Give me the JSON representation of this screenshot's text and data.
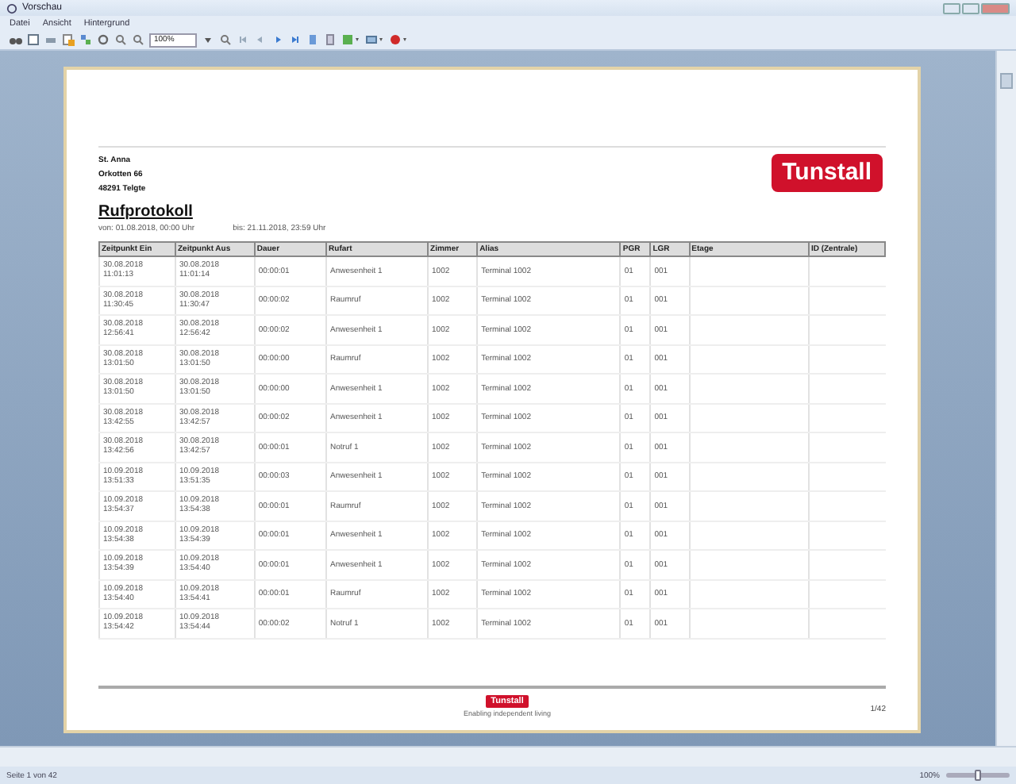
{
  "window": {
    "title": "Vorschau"
  },
  "menu": [
    "Datei",
    "Ansicht",
    "Hintergrund"
  ],
  "toolbar": {
    "zoom": "100%"
  },
  "report": {
    "address": [
      "St. Anna",
      "Orkotten 66",
      "48291 Telgte"
    ],
    "logo": "Tunstall",
    "title": "Rufprotokoll",
    "from": "von: 01.08.2018, 00:00 Uhr",
    "to": "bis: 21.11.2018, 23:59 Uhr",
    "columns": [
      "Zeitpunkt Ein",
      "Zeitpunkt Aus",
      "Dauer",
      "Rufart",
      "Zimmer",
      "Alias",
      "PGR",
      "LGR",
      "Etage",
      "ID (Zentrale)"
    ],
    "rows": [
      [
        "30.08.2018\n11:01:13",
        "30.08.2018\n11:01:14",
        "00:00:01",
        "Anwesenheit 1",
        "1002",
        "Terminal 1002",
        "01",
        "001"
      ],
      [
        "30.08.2018\n11:30:45",
        "30.08.2018\n11:30:47",
        "00:00:02",
        "Raumruf",
        "1002",
        "Terminal 1002",
        "01",
        "001"
      ],
      [
        "30.08.2018\n12:56:41",
        "30.08.2018\n12:56:42",
        "00:00:02",
        "Anwesenheit 1",
        "1002",
        "Terminal 1002",
        "01",
        "001"
      ],
      [
        "30.08.2018\n13:01:50",
        "30.08.2018\n13:01:50",
        "00:00:00",
        "Raumruf",
        "1002",
        "Terminal 1002",
        "01",
        "001"
      ],
      [
        "30.08.2018\n13:01:50",
        "30.08.2018\n13:01:50",
        "00:00:00",
        "Anwesenheit 1",
        "1002",
        "Terminal 1002",
        "01",
        "001"
      ],
      [
        "30.08.2018\n13:42:55",
        "30.08.2018\n13:42:57",
        "00:00:02",
        "Anwesenheit 1",
        "1002",
        "Terminal 1002",
        "01",
        "001"
      ],
      [
        "30.08.2018\n13:42:56",
        "30.08.2018\n13:42:57",
        "00:00:01",
        "Notruf 1",
        "1002",
        "Terminal 1002",
        "01",
        "001"
      ],
      [
        "10.09.2018\n13:51:33",
        "10.09.2018\n13:51:35",
        "00:00:03",
        "Anwesenheit 1",
        "1002",
        "Terminal 1002",
        "01",
        "001"
      ],
      [
        "10.09.2018\n13:54:37",
        "10.09.2018\n13:54:38",
        "00:00:01",
        "Raumruf",
        "1002",
        "Terminal 1002",
        "01",
        "001"
      ],
      [
        "10.09.2018\n13:54:38",
        "10.09.2018\n13:54:39",
        "00:00:01",
        "Anwesenheit 1",
        "1002",
        "Terminal 1002",
        "01",
        "001"
      ],
      [
        "10.09.2018\n13:54:39",
        "10.09.2018\n13:54:40",
        "00:00:01",
        "Anwesenheit 1",
        "1002",
        "Terminal 1002",
        "01",
        "001"
      ],
      [
        "10.09.2018\n13:54:40",
        "10.09.2018\n13:54:41",
        "00:00:01",
        "Raumruf",
        "1002",
        "Terminal 1002",
        "01",
        "001"
      ],
      [
        "10.09.2018\n13:54:42",
        "10.09.2018\n13:54:44",
        "00:00:02",
        "Notruf 1",
        "1002",
        "Terminal 1002",
        "01",
        "001"
      ]
    ],
    "footer_logo": "Tunstall",
    "footer_tagline": "Enabling independent living",
    "page": "1/42"
  },
  "status_bar": {
    "left": "Seite 1 von 42",
    "zoom": "100%",
    "level": 0.5
  }
}
